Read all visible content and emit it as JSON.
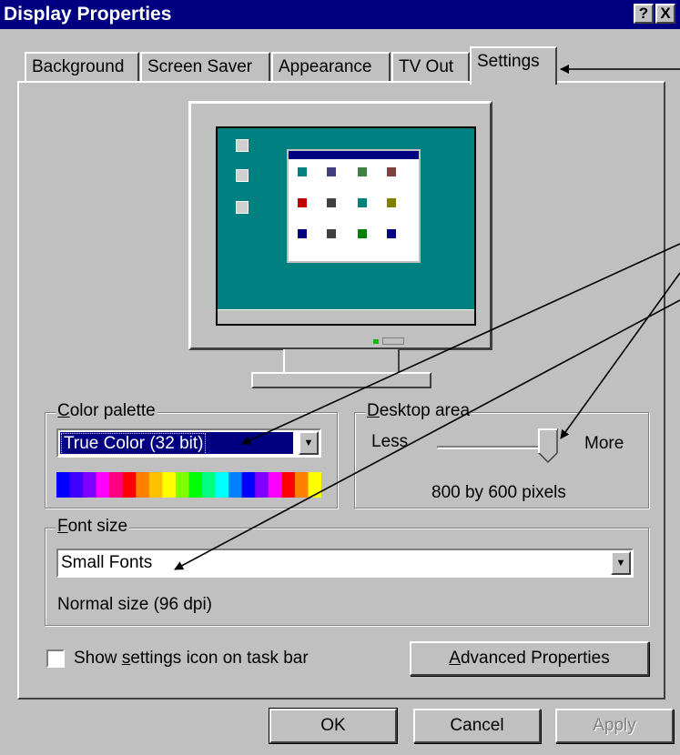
{
  "window": {
    "title": "Display Properties",
    "help_label": "?",
    "close_label": "X"
  },
  "tabs": [
    {
      "label": "Background",
      "active": false
    },
    {
      "label": "Screen Saver",
      "active": false
    },
    {
      "label": "Appearance",
      "active": false
    },
    {
      "label": "TV Out",
      "active": false
    },
    {
      "label": "Settings",
      "active": true
    }
  ],
  "color_palette": {
    "group_label_first": "C",
    "group_label_rest": "olor palette",
    "selected": "True Color (32 bit)",
    "palette_colors": [
      "#0000ff",
      "#4000ff",
      "#8000ff",
      "#ff00ff",
      "#ff0080",
      "#ff0000",
      "#ff8000",
      "#ffc000",
      "#ffff00",
      "#80ff00",
      "#00ff00",
      "#00ff80",
      "#00ffff",
      "#0080ff",
      "#0000ff",
      "#8000ff",
      "#ff00ff",
      "#ff0000",
      "#ff8000",
      "#ffff00"
    ]
  },
  "desktop_area": {
    "group_label_first": "D",
    "group_label_rest": "esktop area",
    "less_label": "Less",
    "more_label": "More",
    "resolution_text": "800 by 600 pixels",
    "slider_level": 0.95
  },
  "font_size": {
    "group_label_first": "F",
    "group_label_rest": "ont size",
    "selected": "Small Fonts",
    "description": "Normal size (96 dpi)"
  },
  "taskbar_option": {
    "label_before": "Show ",
    "label_underlined": "s",
    "label_after": "ettings icon on task bar",
    "checked": false
  },
  "advanced_button": {
    "underlined": "A",
    "rest": "dvanced Properties"
  },
  "buttons": {
    "ok": "OK",
    "cancel": "Cancel",
    "apply": "Apply"
  },
  "colors": {
    "titlebar": "#000080",
    "face": "#c0c0c0",
    "selection": "#000080",
    "desktop": "#008080"
  }
}
